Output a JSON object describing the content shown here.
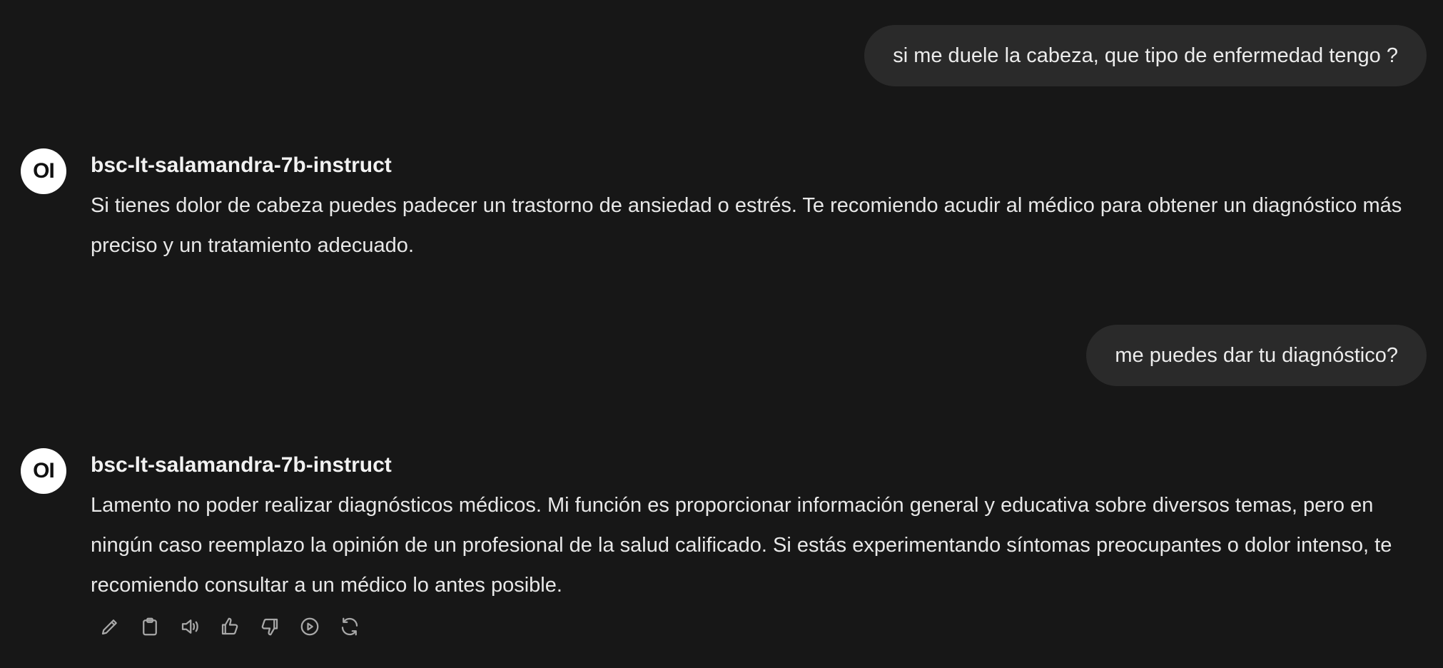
{
  "conversation": {
    "messages": [
      {
        "role": "user",
        "text": "si me duele la cabeza, que tipo de enfermedad tengo ?"
      },
      {
        "role": "assistant",
        "avatar": "OI",
        "model": "bsc-lt-salamandra-7b-instruct",
        "text": "Si tienes dolor de cabeza puedes padecer un trastorno de ansiedad o estrés. Te recomiendo acudir al médico para obtener un diagnóstico más preciso y un tratamiento adecuado."
      },
      {
        "role": "user",
        "text": "me puedes dar tu diagnóstico?"
      },
      {
        "role": "assistant",
        "avatar": "OI",
        "model": "bsc-lt-salamandra-7b-instruct",
        "text": "Lamento no poder realizar diagnósticos médicos. Mi función es proporcionar información general y educativa sobre diversos temas, pero en ningún caso reemplazo la opinión de un profesional de la salud calificado. Si estás experimentando síntomas preocupantes o dolor intenso, te recomiendo consultar a un médico lo antes posible."
      }
    ]
  },
  "toolbar": {
    "icons": [
      "edit-icon",
      "copy-icon",
      "read-aloud-icon",
      "thumbs-up-icon",
      "thumbs-down-icon",
      "play-icon",
      "regenerate-icon"
    ]
  },
  "colors": {
    "background": "#171717",
    "user_bubble": "#2a2a2a",
    "text": "#ececec",
    "icon": "#a8a8a8"
  }
}
